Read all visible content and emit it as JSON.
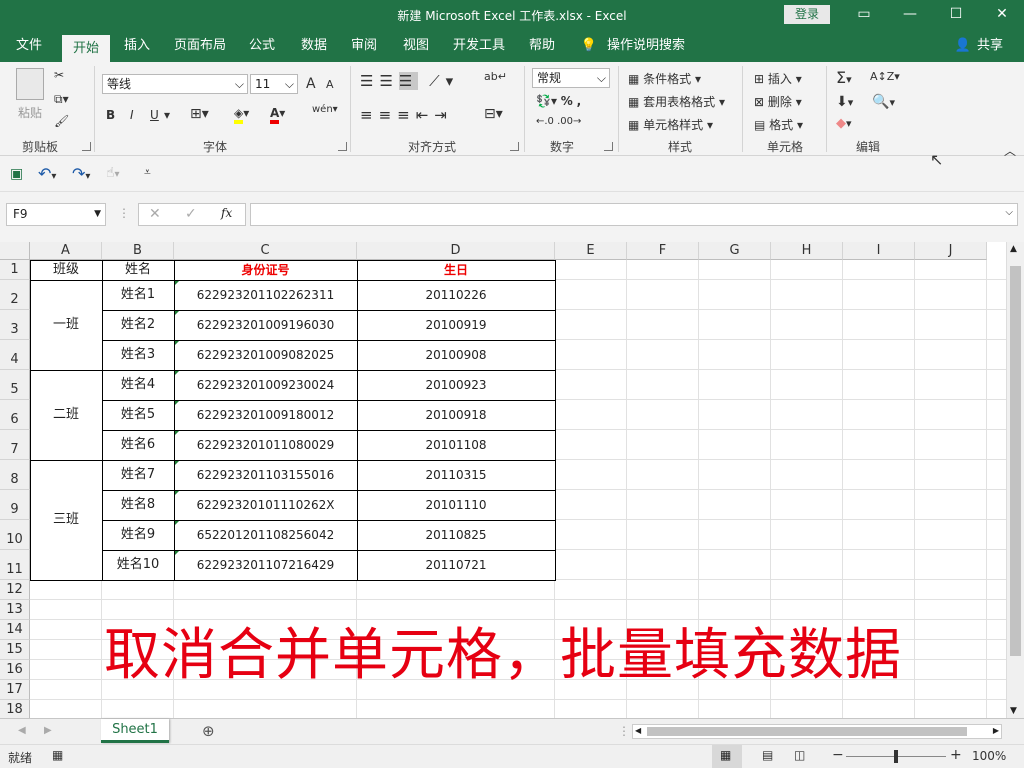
{
  "window": {
    "title": "新建 Microsoft Excel 工作表.xlsx  -  Excel",
    "login": "登录",
    "share": "共享"
  },
  "tabs": [
    "文件",
    "开始",
    "插入",
    "页面布局",
    "公式",
    "数据",
    "审阅",
    "视图",
    "开发工具",
    "帮助"
  ],
  "tell_me": "操作说明搜索",
  "ribbon": {
    "clipboard": {
      "paste": "粘贴",
      "label": "剪贴板"
    },
    "font": {
      "name": "等线",
      "size": "11",
      "label": "字体",
      "bold": "B",
      "italic": "I",
      "underline": "U",
      "grow": "A",
      "shrink": "A"
    },
    "alignment": {
      "label": "对齐方式"
    },
    "number": {
      "format": "常规",
      "label": "数字"
    },
    "styles": {
      "cond": "条件格式",
      "table": "套用表格格式",
      "cell": "单元格样式",
      "label": "样式"
    },
    "cells": {
      "insert": "插入",
      "delete": "删除",
      "format": "格式",
      "label": "单元格"
    },
    "editing": {
      "label": "编辑"
    }
  },
  "namebox": "F9",
  "columns": [
    "A",
    "B",
    "C",
    "D",
    "E",
    "F",
    "G",
    "H",
    "I",
    "J"
  ],
  "rows": [
    "1",
    "2",
    "3",
    "4",
    "5",
    "6",
    "7",
    "8",
    "9",
    "10",
    "11",
    "12",
    "13",
    "14",
    "15",
    "16",
    "17",
    "18"
  ],
  "headers": {
    "class": "班级",
    "name": "姓名",
    "id": "身份证号",
    "birthday": "生日"
  },
  "classes": [
    "一班",
    "二班",
    "三班"
  ],
  "records": [
    {
      "name": "姓名1",
      "id": "622923201102262311",
      "birthday": "20110226"
    },
    {
      "name": "姓名2",
      "id": "622923201009196030",
      "birthday": "20100919"
    },
    {
      "name": "姓名3",
      "id": "622923201009082025",
      "birthday": "20100908"
    },
    {
      "name": "姓名4",
      "id": "622923201009230024",
      "birthday": "20100923"
    },
    {
      "name": "姓名5",
      "id": "622923201009180012",
      "birthday": "20100918"
    },
    {
      "name": "姓名6",
      "id": "622923201011080029",
      "birthday": "20101108"
    },
    {
      "name": "姓名7",
      "id": "622923201103155016",
      "birthday": "20110315"
    },
    {
      "name": "姓名8",
      "id": "62292320101110262X",
      "birthday": "20101110"
    },
    {
      "name": "姓名9",
      "id": "652201201108256042",
      "birthday": "20110825"
    },
    {
      "name": "姓名10",
      "id": "622923201107216429",
      "birthday": "20110721"
    }
  ],
  "overlay": "取消合并单元格，批量填充数据",
  "sheet": "Sheet1",
  "status": {
    "ready": "就绪",
    "zoom": "100%"
  },
  "colors": {
    "accent": "#217346",
    "header_red": "#e00000",
    "overlay_red": "#e60012"
  }
}
